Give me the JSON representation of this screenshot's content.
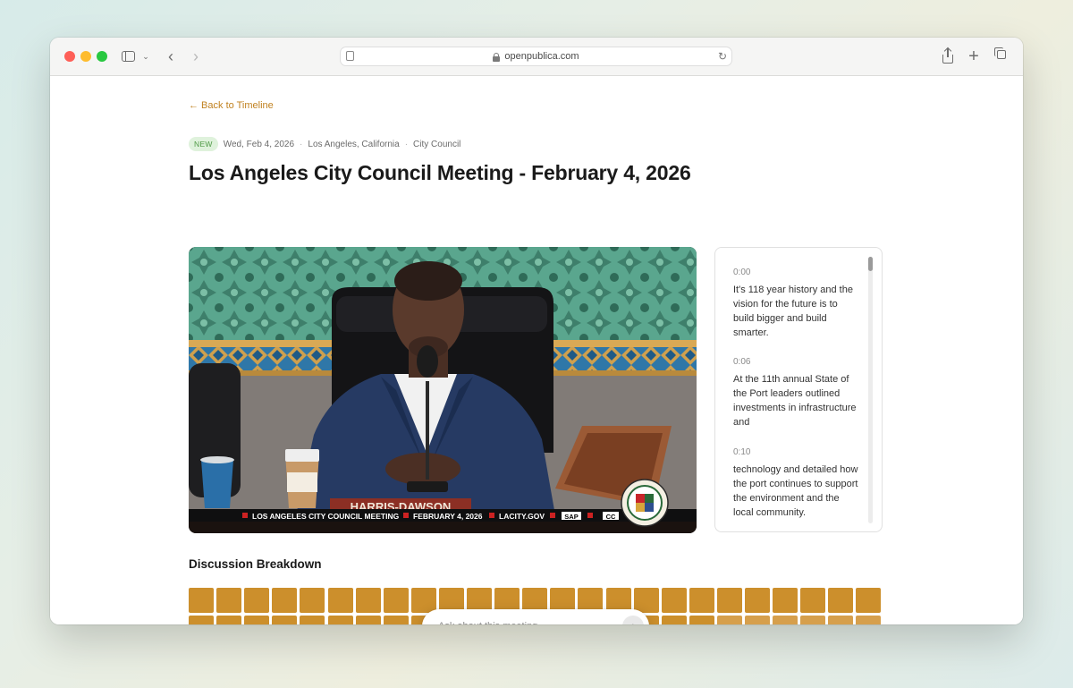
{
  "browser": {
    "url": "openpublica.com"
  },
  "page": {
    "back_link": "← Back to Timeline",
    "badge": "NEW",
    "date": "Wed, Feb 4, 2026",
    "location": "Los Angeles, California",
    "body": "City Council",
    "title": "Los Angeles City Council Meeting - February 4, 2026"
  },
  "video": {
    "nameplate": "HARRIS-DAWSON",
    "ticker": [
      "LOS ANGELES CITY COUNCIL MEETING",
      "FEBRUARY 4, 2026",
      "LACITY.GOV",
      "SAP",
      "CC"
    ]
  },
  "transcript": [
    {
      "time": "0:00",
      "text": "It's 118 year history and the vision for the future is to build bigger and build smarter."
    },
    {
      "time": "0:06",
      "text": "At the 11th annual State of the Port leaders outlined investments in infrastructure and"
    },
    {
      "time": "0:10",
      "text": "technology and detailed how the port continues to support the environment and the local community."
    }
  ],
  "discussion": {
    "title": "Discussion Breakdown",
    "colors": {
      "dark": "#cc8f2c",
      "medium": "#d69f4c",
      "light": "#dfb06a"
    }
  },
  "ask": {
    "placeholder": "Ask about this meeting"
  }
}
